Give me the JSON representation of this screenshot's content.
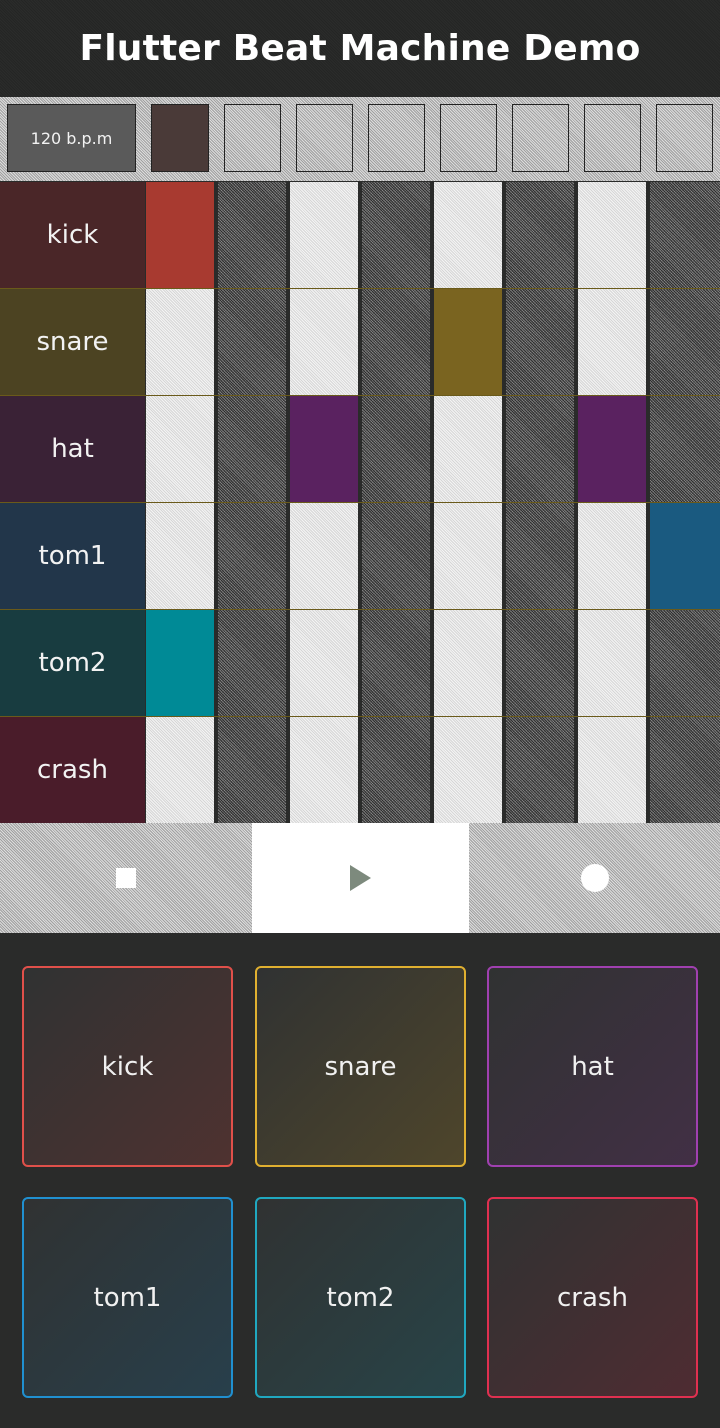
{
  "app": {
    "title": "Flutter Beat Machine Demo"
  },
  "topbar": {
    "bpm_label": "120 b.p.m"
  },
  "tracks": [
    {
      "name": "kick",
      "color": "#a83a30",
      "label_bg": "#4a2628",
      "steps": [
        true,
        false,
        false,
        false,
        false,
        false,
        false,
        false
      ]
    },
    {
      "name": "snare",
      "color": "#7a6420",
      "label_bg": "#4c4322",
      "steps": [
        false,
        false,
        false,
        false,
        true,
        false,
        false,
        false
      ]
    },
    {
      "name": "hat",
      "color": "#5a2260",
      "label_bg": "#3a2236",
      "steps": [
        false,
        false,
        true,
        false,
        false,
        false,
        true,
        false
      ]
    },
    {
      "name": "tom1",
      "color": "#1a5a80",
      "label_bg": "#22364a",
      "steps": [
        false,
        false,
        false,
        false,
        false,
        false,
        false,
        true
      ]
    },
    {
      "name": "tom2",
      "color": "#008a96",
      "label_bg": "#183c40",
      "steps": [
        true,
        false,
        false,
        false,
        false,
        false,
        false,
        false
      ]
    },
    {
      "name": "crash",
      "color": "#8a2030",
      "label_bg": "#4a1c2a",
      "steps": [
        false,
        false,
        false,
        false,
        false,
        false,
        false,
        false
      ]
    }
  ],
  "transport": {
    "stop_icon": "stop-icon",
    "play_icon": "play-icon",
    "record_icon": "record-icon"
  },
  "pads": [
    {
      "label": "kick",
      "border": "#e0504a"
    },
    {
      "label": "snare",
      "border": "#e0b030"
    },
    {
      "label": "hat",
      "border": "#a040b0"
    },
    {
      "label": "tom1",
      "border": "#2090d0"
    },
    {
      "label": "tom2",
      "border": "#20a8c0"
    },
    {
      "label": "crash",
      "border": "#e03050"
    }
  ]
}
